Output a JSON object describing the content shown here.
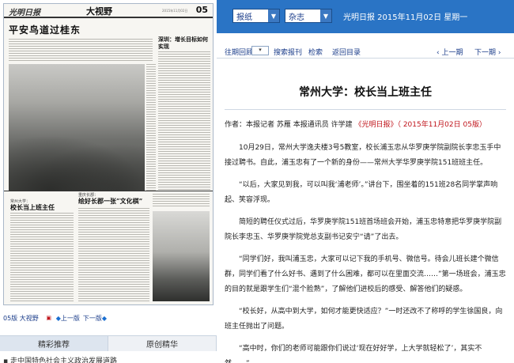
{
  "newspaper": {
    "masthead": "光明日报",
    "section": "大视野",
    "issue_date": "2015年11月02日",
    "page_no": "05",
    "headline_main": "平安鸟道过桂东",
    "headline_side": "深圳：增长目标如何实现",
    "headline_bottom_left": "校长当上班主任",
    "headline_bottom_left_kicker": "常州大学：",
    "headline_bottom_mid": "绘好长郡一张“文化棋”",
    "headline_bottom_mid_kicker": "重庆长郡："
  },
  "page_nav": {
    "current": "05版 大视野",
    "pdf_icon": "pdf-icon",
    "prev": "上一版",
    "next": "下一版"
  },
  "tabs": [
    {
      "label": "精彩推荐",
      "active": true
    },
    {
      "label": "原创精华",
      "active": false
    }
  ],
  "recommend_first": "▪ 走中国特色社会主义政治发展道路",
  "topbar": {
    "type_select": "报纸",
    "pub_select": "杂志",
    "title": "光明日报  2015年11月02日  星期一"
  },
  "navbar": {
    "past_review": "往期回顾",
    "search": "搜索报刊",
    "search_btn": "检索",
    "archive": "返回目录",
    "prev": "上一期",
    "next": "下一期"
  },
  "article": {
    "title": "常州大学：校长当上班主任",
    "byline_authors": "作者：本报记者 苏雁 本报通讯员 许学建",
    "byline_source": "《光明日报》（ 2015年11月02日 05版）",
    "paragraphs": [
      "10月29日，常州大学逸夫楼3号5教室，校长浦玉忠从华罗庚学院副院长李忠玉手中接过聘书。自此，浦玉忠有了一个新的身份——常州大学华罗庚学院151班班主任。",
      "“以后，大家见到我，可以叫我‘浦老师’。”讲台下，围坐着的151班28名同学掌声响起、笑容浮现。",
      "简短的聘任仪式过后，华罗庚学院151班首场班会开始，浦玉忠特意把华罗庚学院副院长李忠玉、华罗庚学院党总支副书记安宁“请”了出去。",
      "“同学们好，我叫浦玉忠，大家可以记下我的手机号、微信号。待会儿班长建个微信群，同学们看了什么好书、遇到了什么困难，都可以在里面交流……”第一场班会，浦玉忠的目的就是跟学生们“混个脸熟”，了解他们进校后的感受、解答他们的疑惑。",
      "“校长好，从高中到大学，如何才能更快适应？”一时还改不了称呼的学生徐国良，向班主任抛出了问题。",
      "“高中时，你们的老师可能跟你们说过‘现在好好学，上大学就轻松了’，其实不然……”"
    ]
  },
  "colors": {
    "topbar_bg": "#2a74c5",
    "link": "#1a3c8a",
    "source_red": "#c0141b"
  }
}
